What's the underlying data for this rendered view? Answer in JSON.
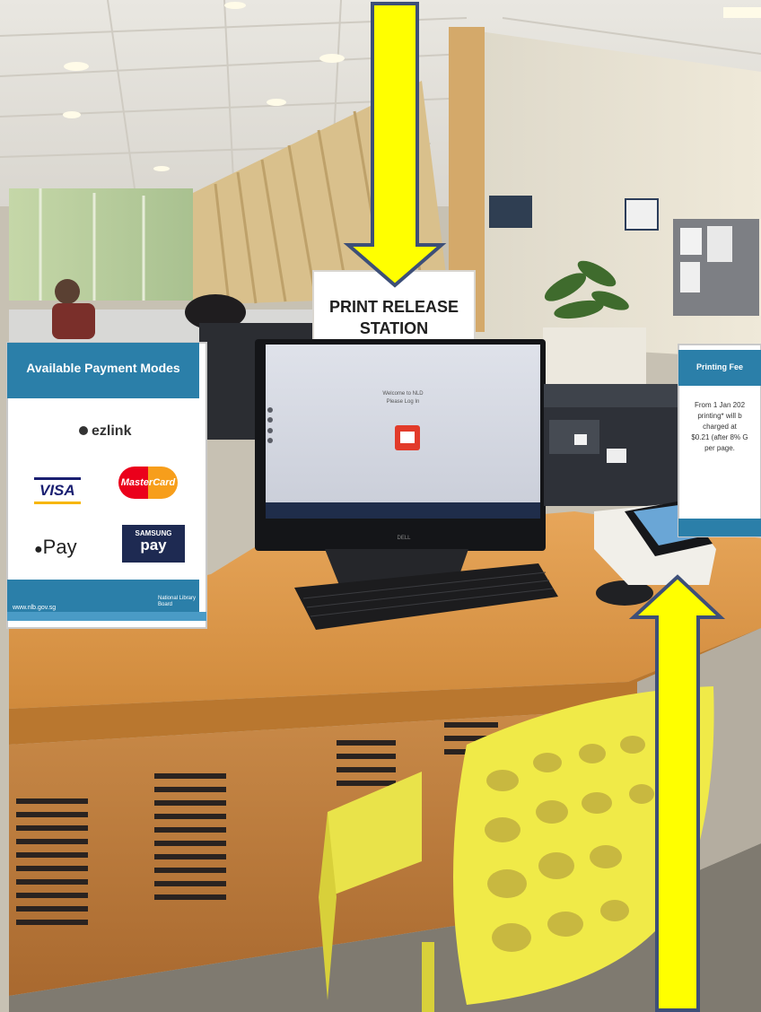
{
  "print_release_sign": {
    "line1": "PRINT RELEASE",
    "line2": "STATION"
  },
  "payment_sign": {
    "title": "Available Payment Modes",
    "methods": [
      "ezlink",
      "VISA",
      "MasterCard",
      "Pay",
      "SAMSUNG",
      "pay"
    ],
    "footer_url": "www.nlb.gov.sg",
    "footer_logo": "National Library Board"
  },
  "fee_sign": {
    "title": "Printing Fee",
    "lines": [
      "From 1 Jan 202",
      "printing* will b",
      "charged at",
      "$0.21 (after 8% G",
      "per page."
    ]
  },
  "monitor": {
    "brand": "DELL",
    "welcome_line1": "Welcome to NLD",
    "welcome_line2": "Please Log In"
  },
  "arrows": {
    "color": "#ffff00",
    "outline": "#3d4f78"
  }
}
